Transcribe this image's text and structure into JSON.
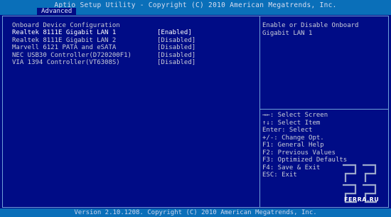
{
  "header": {
    "title": "Aptio Setup Utility - Copyright (C) 2010 American Megatrends, Inc.",
    "active_tab": "Advanced"
  },
  "main": {
    "section_title": "Onboard Device Configuration",
    "items": [
      {
        "label": "Realtek 8111E Gigabit LAN 1",
        "value": "[Enabled]",
        "selected": true
      },
      {
        "label": "Realtek 8111E Gigabit LAN 2",
        "value": "[Disabled]",
        "selected": false
      },
      {
        "label": "Marvell 6121 PATA and eSATA",
        "value": "[Disabled]",
        "selected": false
      },
      {
        "label": "NEC USB30 Controller(D720200F1)",
        "value": "[Disabled]",
        "selected": false
      },
      {
        "label": "VIA 1394 Controller(VT6308S)",
        "value": "[Disabled]",
        "selected": false
      }
    ]
  },
  "help": {
    "text": "Enable or Disable Onboard Gigabit LAN 1",
    "keys": [
      "→←: Select Screen",
      "↑↓: Select Item",
      "Enter: Select",
      "+/-: Change Opt.",
      "F1: General Help",
      "F2: Previous Values",
      "F3: Optimized Defaults",
      "F4: Save & Exit",
      "ESC: Exit"
    ]
  },
  "footer": {
    "version": "Version 2.10.1208. Copyright (C) 2010 American Megatrends, Inc."
  },
  "watermark": {
    "text": "FERRA.RU"
  },
  "colors": {
    "background": "#000c86",
    "bar": "#0a6fb9",
    "border": "#6fa0d8",
    "text": "#c9ccd8",
    "selected_text": "#ffffff"
  }
}
